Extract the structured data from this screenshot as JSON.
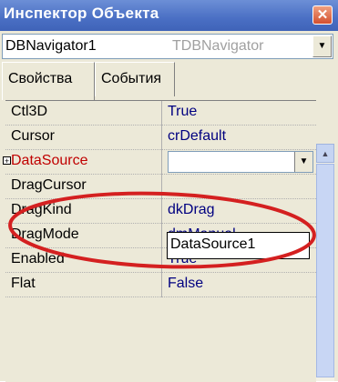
{
  "window": {
    "title": "Инспектор Объекта",
    "close_icon": "close-icon"
  },
  "object_selector": {
    "name": "DBNavigator1",
    "type": "TDBNavigator",
    "dropdown_icon": "chevron-down-icon"
  },
  "tabs": [
    {
      "label": "Свойства",
      "active": true
    },
    {
      "label": "События",
      "active": false
    }
  ],
  "properties": [
    {
      "name": "Ctl3D",
      "value": "True"
    },
    {
      "name": "Cursor",
      "value": "crDefault"
    },
    {
      "name": "DataSource",
      "value": "",
      "expandable": true,
      "selected": true
    },
    {
      "name": "DragCursor",
      "value": ""
    },
    {
      "name": "DragKind",
      "value": "dkDrag"
    },
    {
      "name": "DragMode",
      "value": "dmManual"
    },
    {
      "name": "Enabled",
      "value": "True"
    },
    {
      "name": "Flat",
      "value": "False"
    }
  ],
  "dropdown_options": [
    "DataSource1"
  ],
  "highlight_color": "#d42020"
}
